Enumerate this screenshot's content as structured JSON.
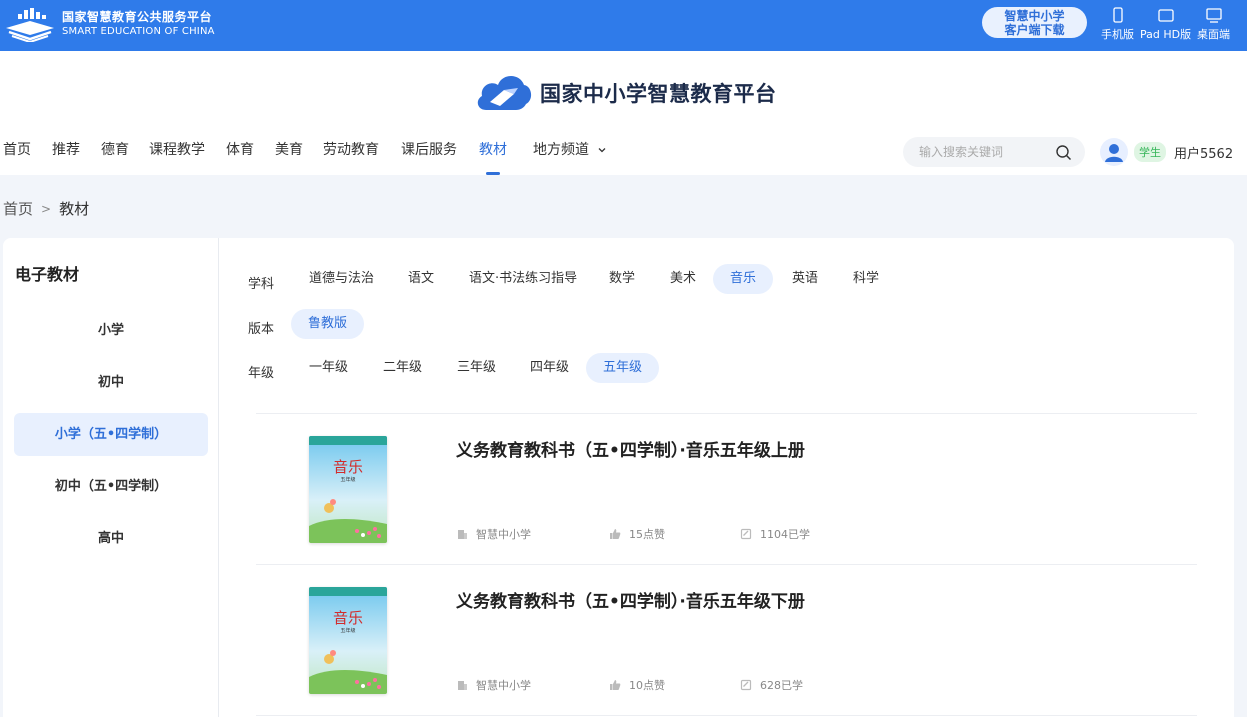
{
  "topbar": {
    "brand_cn": "国家智慧教育公共服务平台",
    "brand_en": "SMART EDUCATION OF CHINA",
    "download_line1": "智慧中小学",
    "download_line2": "客户端下载",
    "devices": [
      {
        "label": "手机版",
        "icon": "phone-icon"
      },
      {
        "label": "Pad HD版",
        "icon": "tablet-icon"
      },
      {
        "label": "桌面端",
        "icon": "desktop-icon"
      }
    ]
  },
  "header": {
    "site_title": "国家中小学智慧教育平台",
    "nav": [
      "首页",
      "推荐",
      "德育",
      "课程教学",
      "体育",
      "美育",
      "劳动教育",
      "课后服务",
      "教材",
      "地方频道"
    ],
    "active_nav": "教材",
    "search_placeholder": "输入搜索关键词",
    "role_badge": "学生",
    "username": "用户5562"
  },
  "breadcrumb": {
    "home": "首页",
    "separator": ">",
    "current": "教材"
  },
  "sidebar": {
    "title": "电子教材",
    "items": [
      "小学",
      "初中",
      "小学（五•四学制）",
      "初中（五•四学制）",
      "高中"
    ],
    "active_item": "小学（五•四学制）"
  },
  "filters": {
    "subject_label": "学科",
    "subjects": [
      "道德与法治",
      "语文",
      "语文·书法练习指导",
      "数学",
      "美术",
      "音乐",
      "英语",
      "科学"
    ],
    "active_subject": "音乐",
    "edition_label": "版本",
    "editions": [
      "鲁教版"
    ],
    "active_edition": "鲁教版",
    "grade_label": "年级",
    "grades": [
      "一年级",
      "二年级",
      "三年级",
      "四年级",
      "五年级"
    ],
    "active_grade": "五年级"
  },
  "books": [
    {
      "title": "义务教育教科书（五•四学制）·音乐五年级上册",
      "cover_text": "音乐",
      "cover_sub": "五年级",
      "publisher": "智慧中小学",
      "likes": "15点赞",
      "learners": "1104已学"
    },
    {
      "title": "义务教育教科书（五•四学制）·音乐五年级下册",
      "cover_text": "音乐",
      "cover_sub": "五年级",
      "publisher": "智慧中小学",
      "likes": "10点赞",
      "learners": "628已学"
    }
  ],
  "colors": {
    "topbar": "#2f7bea",
    "accent": "#2f6fd8",
    "active_bg": "#e8f0fe",
    "page_bg": "#f2f5fa",
    "student_badge": "#35b558"
  }
}
